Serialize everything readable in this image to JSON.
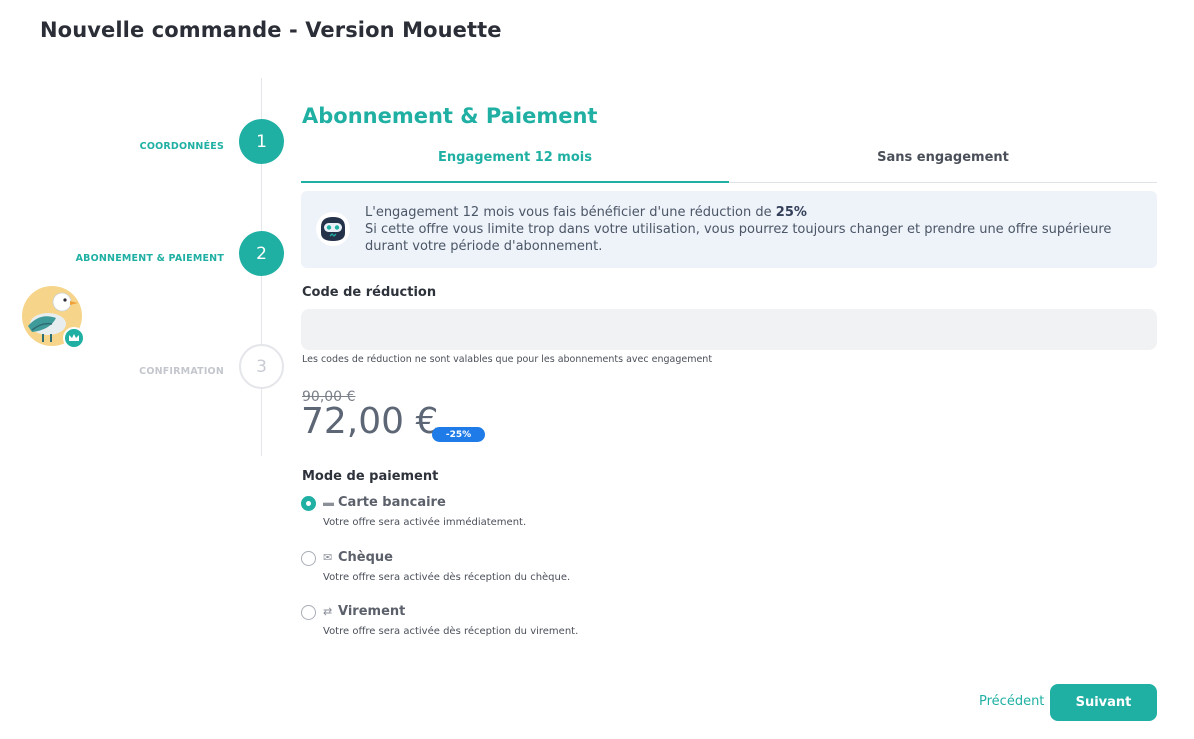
{
  "page": {
    "title": "Nouvelle commande - Version Mouette"
  },
  "stepper": {
    "steps": [
      {
        "number": "1",
        "label": "COORDONNÉES",
        "state": "done"
      },
      {
        "number": "2",
        "label": "ABONNEMENT & PAIEMENT",
        "state": "current"
      },
      {
        "number": "3",
        "label": "CONFIRMATION",
        "state": "pending"
      }
    ]
  },
  "section": {
    "title": "Abonnement & Paiement"
  },
  "tabs": [
    {
      "label": "Engagement 12 mois",
      "selected": true
    },
    {
      "label": "Sans engagement",
      "selected": false
    }
  ],
  "info": {
    "line1_prefix": "L'engagement 12 mois vous fais bénéficier d'une réduction de ",
    "line1_bold": "25%",
    "line2": "Si cette offre vous limite trop dans votre utilisation, vous pourrez toujours changer et prendre une offre supérieure durant votre période d'abonnement."
  },
  "discount_code": {
    "label": "Code de réduction",
    "value": "",
    "hint": "Les codes de réduction ne sont valables que pour les abonnements avec engagement"
  },
  "price": {
    "old": "90,00 €",
    "current": "72,00 €",
    "badge": "-25%"
  },
  "payment": {
    "label": "Mode de paiement",
    "options": [
      {
        "icon": "credit-card-icon",
        "glyph": "▬",
        "label": "Carte bancaire",
        "description": "Votre offre sera activée immédiatement.",
        "checked": true
      },
      {
        "icon": "envelope-icon",
        "glyph": "✉",
        "label": "Chèque",
        "description": "Votre offre sera activée dès réception du chèque.",
        "checked": false
      },
      {
        "icon": "transfer-icon",
        "glyph": "⇄",
        "label": "Virement",
        "description": "Votre offre sera activée dès réception du virement.",
        "checked": false
      }
    ]
  },
  "actions": {
    "previous": "Précédent",
    "next": "Suivant"
  },
  "colors": {
    "accent": "#1fb0a3",
    "badge": "#1f7be8",
    "info_bg": "#eef2f9"
  }
}
